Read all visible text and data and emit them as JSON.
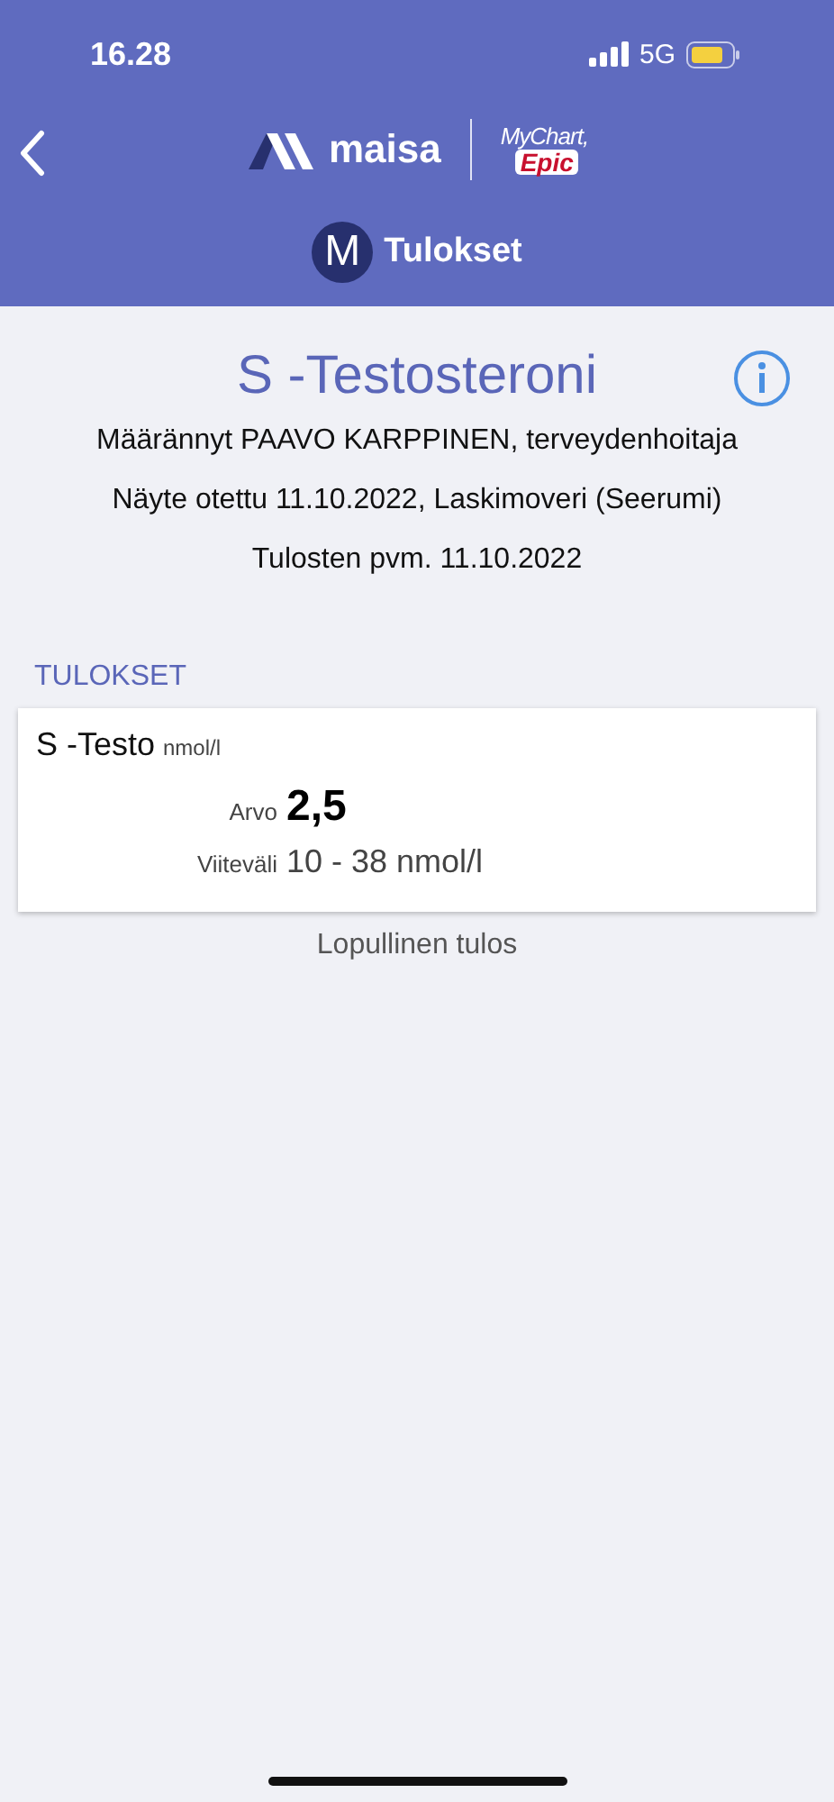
{
  "status_bar": {
    "time": "16.28",
    "network": "5G"
  },
  "header": {
    "brand": "maisa",
    "partner_line1": "MyChart,",
    "partner_line2": "Epic",
    "avatar_letter": "M",
    "title": "Tulokset"
  },
  "test": {
    "title": "S -Testosteroni",
    "details": [
      "Määrännyt PAAVO KARPPINEN, terveydenhoitaja",
      "Näyte otettu 11.10.2022, Laskimoveri (Seerumi)",
      "Tulosten pvm. 11.10.2022"
    ]
  },
  "section_label": "TULOKSET",
  "result": {
    "name": "S -Testo",
    "unit": "nmol/l",
    "value_label": "Arvo",
    "value": "2,5",
    "range_label": "Viiteväli",
    "range": "10 - 38 nmol/l"
  },
  "status_text": "Lopullinen tulos"
}
